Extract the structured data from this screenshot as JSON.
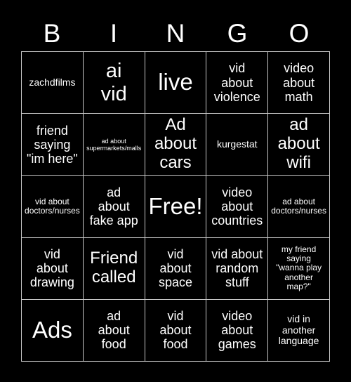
{
  "card": {
    "title_letters": [
      "B",
      "I",
      "N",
      "G",
      "O"
    ],
    "background_color": "#000000",
    "text_color": "#ffffff",
    "border_color": "#c8c8c8",
    "rows": 5,
    "columns": 5,
    "cells": [
      {
        "text": "zachdfilms",
        "size": "s-sm"
      },
      {
        "text": "ai\nvid",
        "size": "s-xl"
      },
      {
        "text": "live",
        "size": "s-xxl"
      },
      {
        "text": "vid\nabout\nviolence",
        "size": "s-md"
      },
      {
        "text": "video\nabout\nmath",
        "size": "s-md"
      },
      {
        "text": "friend\nsaying\n\"im here\"",
        "size": "s-md"
      },
      {
        "text": "ad about\nsupermarkets/malls",
        "size": "s-xxs"
      },
      {
        "text": "Ad\nabout\ncars",
        "size": "s-lg"
      },
      {
        "text": "kurgestat",
        "size": "s-sm"
      },
      {
        "text": "ad\nabout\nwifi",
        "size": "s-lg"
      },
      {
        "text": "vid about\ndoctors/nurses",
        "size": "s-xs"
      },
      {
        "text": "ad\nabout\nfake app",
        "size": "s-md"
      },
      {
        "text": "Free!",
        "size": "s-xxl"
      },
      {
        "text": "video\nabout\ncountries",
        "size": "s-md"
      },
      {
        "text": "ad about\ndoctors/nurses",
        "size": "s-xs"
      },
      {
        "text": "vid\nabout\ndrawing",
        "size": "s-md"
      },
      {
        "text": "Friend\ncalled",
        "size": "s-lg"
      },
      {
        "text": "vid\nabout\nspace",
        "size": "s-md"
      },
      {
        "text": "vid about\nrandom\nstuff",
        "size": "s-md"
      },
      {
        "text": "my friend\nsaying\n\"wanna play\nanother\nmap?\"",
        "size": "s-xs"
      },
      {
        "text": "Ads",
        "size": "s-xxl"
      },
      {
        "text": "ad\nabout\nfood",
        "size": "s-md"
      },
      {
        "text": "vid\nabout\nfood",
        "size": "s-md"
      },
      {
        "text": "video\nabout\ngames",
        "size": "s-md"
      },
      {
        "text": "vid in\nanother\nlanguage",
        "size": "s-sm"
      }
    ]
  }
}
